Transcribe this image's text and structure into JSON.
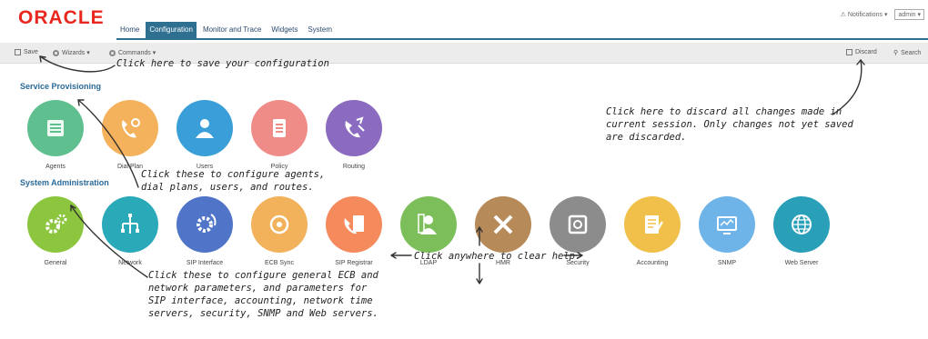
{
  "header": {
    "logo": "ORACLE",
    "tabs": [
      {
        "label": "Home"
      },
      {
        "label": "Configuration"
      },
      {
        "label": "Monitor and Trace"
      },
      {
        "label": "Widgets"
      },
      {
        "label": "System"
      }
    ],
    "notifications": "Notifications ▾",
    "user": "admin ▾"
  },
  "toolbar": {
    "save": "Save",
    "wizards": "Wizards ▾",
    "commands": "Commands ▾",
    "discard": "Discard",
    "search": "Search"
  },
  "sections": {
    "service_provisioning": "Service Provisioning",
    "system_administration": "System Administration"
  },
  "service_tiles": [
    {
      "label": "Agents",
      "color": "#5fbf8f",
      "icon": "agents-icon"
    },
    {
      "label": "Dial Plan",
      "color": "#f5b25c",
      "icon": "dial-plan-icon"
    },
    {
      "label": "Users",
      "color": "#3a9fd8",
      "icon": "users-icon"
    },
    {
      "label": "Policy",
      "color": "#f08c88",
      "icon": "policy-icon"
    },
    {
      "label": "Routing",
      "color": "#8b6bbf",
      "icon": "routing-icon"
    }
  ],
  "admin_tiles": [
    {
      "label": "General",
      "color": "#8cc63f",
      "icon": "gears-icon"
    },
    {
      "label": "Network",
      "color": "#2aa9b8",
      "icon": "network-icon"
    },
    {
      "label": "SIP Interface",
      "color": "#4f74c8",
      "icon": "sip-interface-icon"
    },
    {
      "label": "ECB Sync",
      "color": "#f2b25c",
      "icon": "sync-icon"
    },
    {
      "label": "SIP Registrar",
      "color": "#f58a5c",
      "icon": "registrar-icon"
    },
    {
      "label": "LDAP",
      "color": "#7cbf5a",
      "icon": "ldap-icon"
    },
    {
      "label": "HMR",
      "color": "#b78a5a",
      "icon": "tools-icon"
    },
    {
      "label": "Security",
      "color": "#8c8c8c",
      "icon": "safe-icon"
    },
    {
      "label": "Accounting",
      "color": "#f0c04a",
      "icon": "accounting-icon"
    },
    {
      "label": "SNMP",
      "color": "#6fb4e8",
      "icon": "monitor-icon"
    },
    {
      "label": "Web Server",
      "color": "#2a9fb8",
      "icon": "globe-icon"
    }
  ],
  "annotations": {
    "save_note": "Click here to save your configuration",
    "discard_note": [
      "Click here to discard all changes made in",
      "current session.  Only changes not yet saved",
      "are discarded."
    ],
    "service_note": [
      "Click these to configure agents,",
      "dial plans, users, and routes."
    ],
    "clear_note": "Click anywhere to clear help.",
    "admin_note": [
      "Click these to configure general ECB and",
      "network parameters, and parameters for",
      "SIP interface, accounting, network time",
      "servers, security, SNMP and Web servers."
    ]
  }
}
